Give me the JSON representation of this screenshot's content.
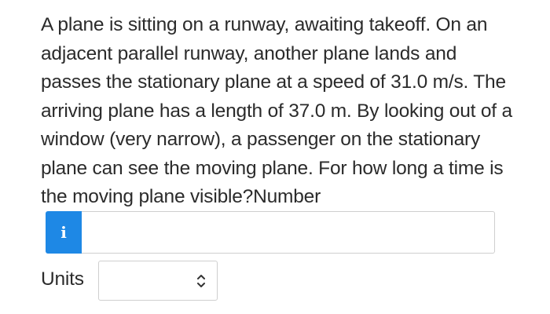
{
  "question": {
    "text": "A plane is sitting on a runway, awaiting takeoff. On an adjacent parallel runway, another plane lands and passes the stationary plane at a speed of 31.0 m/s. The arriving plane has a length of 37.0 m. By looking out of a window (very narrow), a passenger on the stationary plane can see the moving plane. For how long a time is the moving plane visible?Number"
  },
  "answer": {
    "info_icon_glyph": "i",
    "number_value": "",
    "number_placeholder": ""
  },
  "units": {
    "label": "Units",
    "selected": ""
  },
  "colors": {
    "info_button_bg": "#1e88e5",
    "text": "#2b2b2b",
    "border": "#cfcfcf"
  },
  "icons": {
    "info": "info-icon",
    "select_arrows": "chevron-up-down-icon"
  }
}
